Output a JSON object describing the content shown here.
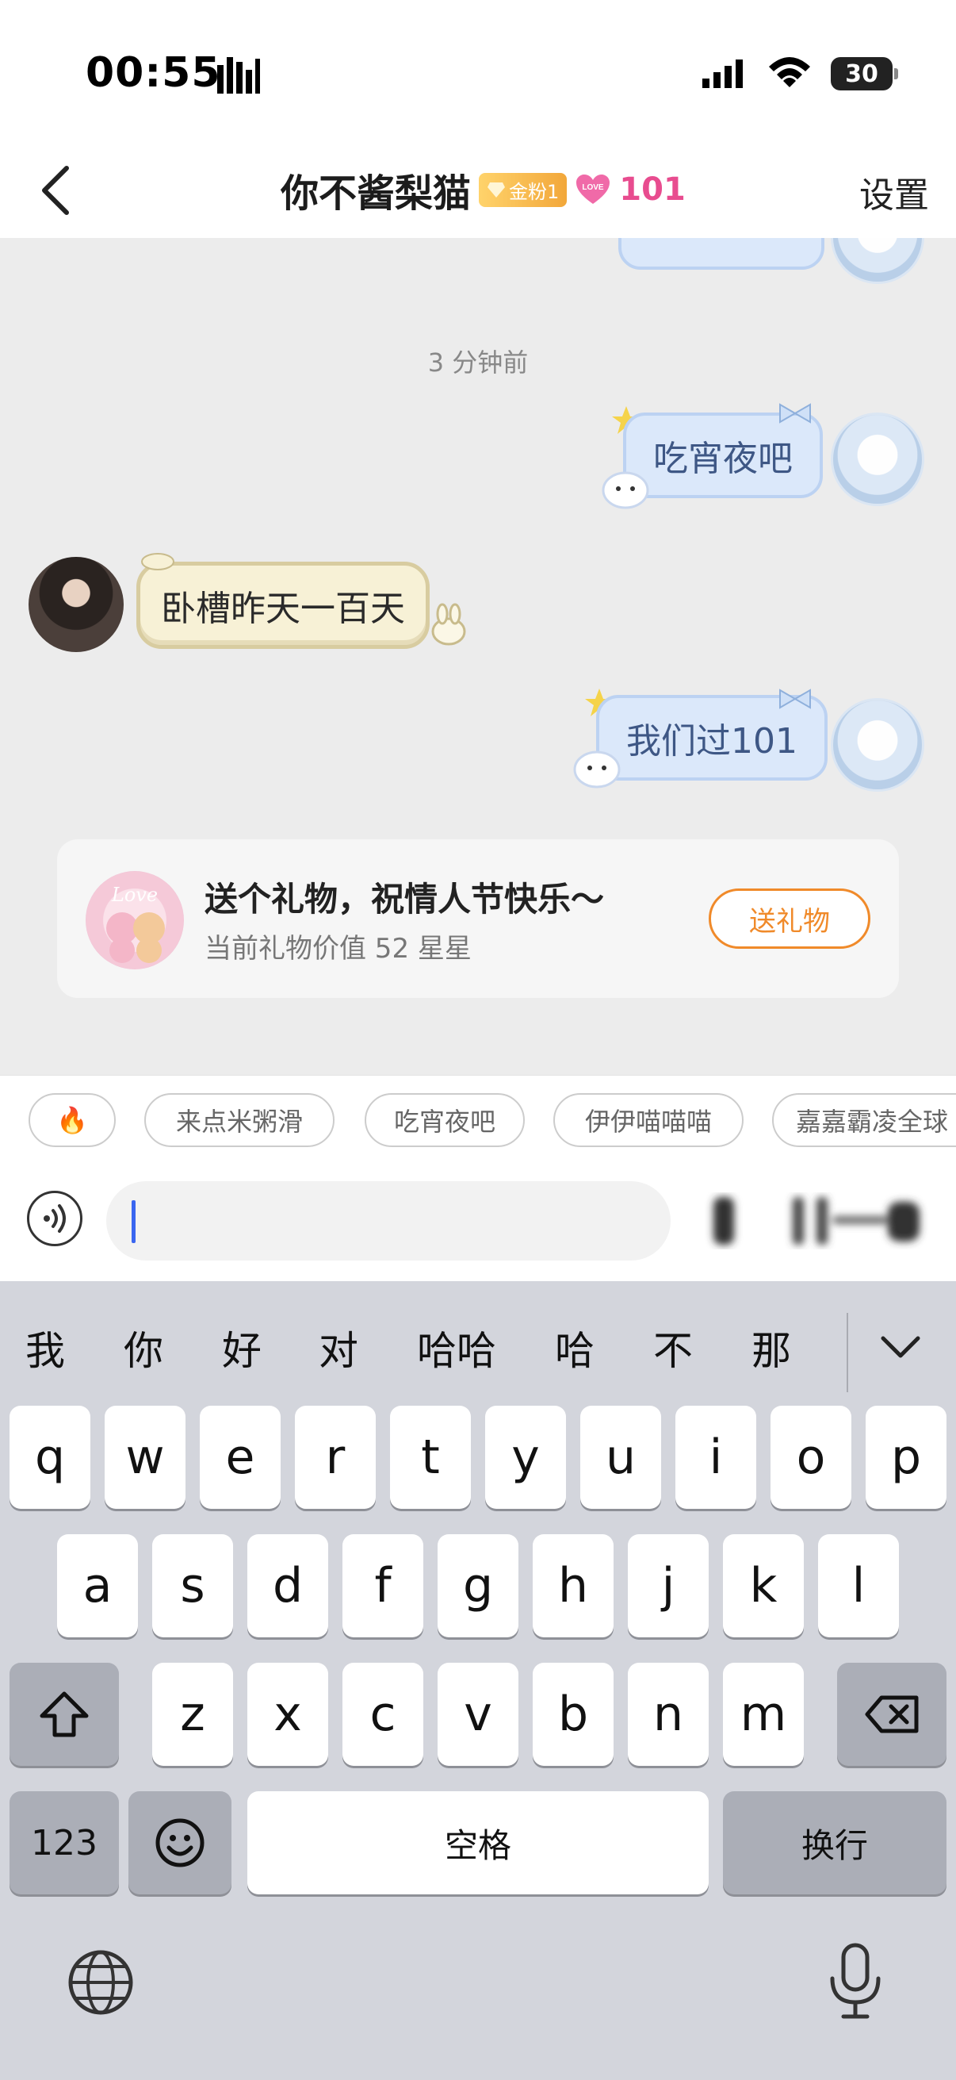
{
  "status_bar": {
    "time": "00:55",
    "battery": "30"
  },
  "header": {
    "title": "你不酱梨猫",
    "fan_badge": "金粉1",
    "love_badge": "LOVE",
    "love_count": "101",
    "settings": "设置"
  },
  "chat": {
    "timestamp": "3 分钟前",
    "messages": [
      {
        "side": "right",
        "text": "吃宵夜吧"
      },
      {
        "side": "left",
        "text": "卧槽昨天一百天"
      },
      {
        "side": "right",
        "text": "我们过101"
      }
    ]
  },
  "gift_card": {
    "title": "送个礼物，祝情人节快乐～",
    "subtitle": "当前礼物价值 52 星星",
    "image_text": "Love",
    "button": "送礼物"
  },
  "quick_replies": [
    "🔥",
    "来点米粥滑",
    "吃宵夜吧",
    "伊伊喵喵喵",
    "嘉嘉霸凌全球"
  ],
  "input": {
    "value": "",
    "placeholder": ""
  },
  "keyboard": {
    "candidates": [
      "我",
      "你",
      "好",
      "对",
      "哈哈",
      "哈",
      "不",
      "那"
    ],
    "row1": [
      "q",
      "w",
      "e",
      "r",
      "t",
      "y",
      "u",
      "i",
      "o",
      "p"
    ],
    "row2": [
      "a",
      "s",
      "d",
      "f",
      "g",
      "h",
      "j",
      "k",
      "l"
    ],
    "row3": [
      "z",
      "x",
      "c",
      "v",
      "b",
      "n",
      "m"
    ],
    "numbers_key": "123",
    "space_key": "空格",
    "return_key": "换行"
  },
  "colors": {
    "accent": "#f08a2a",
    "love": "#e84c8f",
    "bubble_right_text": "#3e5785",
    "caret": "#3a66f0"
  }
}
